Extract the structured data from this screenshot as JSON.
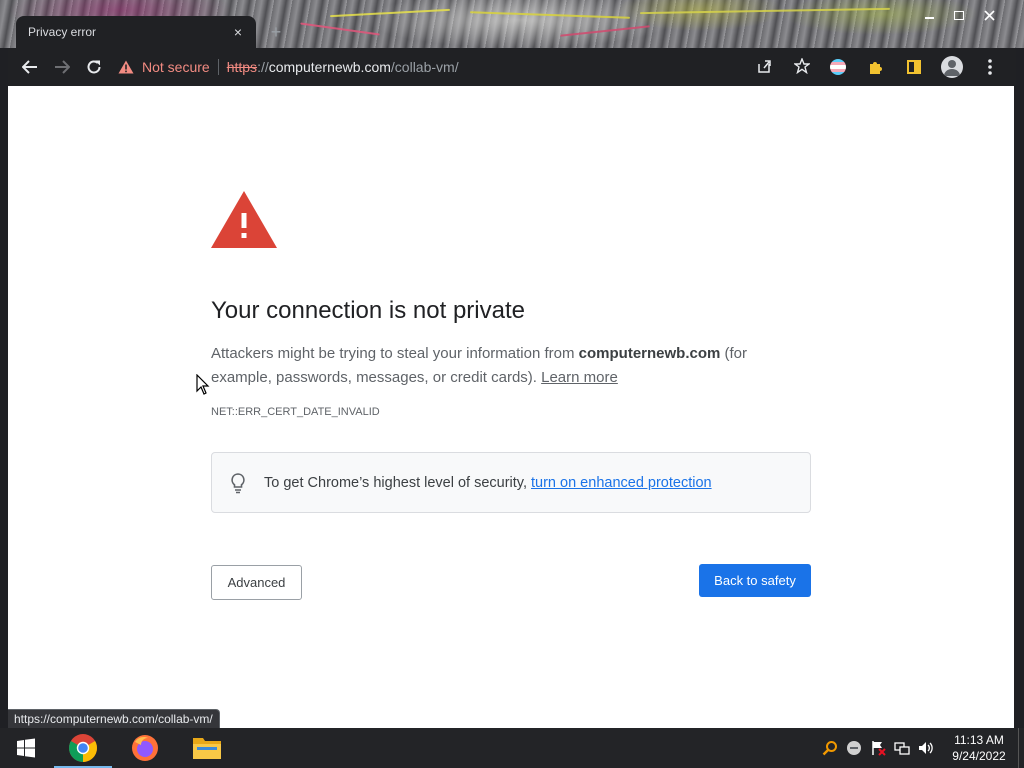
{
  "window": {
    "tab_title": "Privacy error",
    "tab_close": "×",
    "new_tab": "+"
  },
  "toolbar": {
    "security_label": "Not secure",
    "url_scheme": "https",
    "url_sep": "://",
    "url_host": "computernewb.com",
    "url_path": "/collab-vm/"
  },
  "page": {
    "heading": "Your connection is not private",
    "explain_pre": "Attackers might be trying to steal your information from ",
    "explain_host": "computernewb.com",
    "explain_post": " (for example, passwords, messages, or credit cards). ",
    "learn_more": "Learn more",
    "error_code": "NET::ERR_CERT_DATE_INVALID",
    "protection_text": "To get Chrome’s highest level of security,",
    "protection_link": "turn on enhanced protection",
    "advanced_button": "Advanced",
    "back_button": "Back to safety"
  },
  "status_bubble": "https://computernewb.com/collab-vm/",
  "taskbar": {
    "apps": [
      "chrome-icon",
      "firefox-icon",
      "file-explorer-icon"
    ],
    "time": "11:13 AM",
    "date": "9/24/2022"
  },
  "colors": {
    "warning_red": "#db4437",
    "primary_blue": "#1a73e8",
    "not_secure_red": "#f28b82"
  }
}
